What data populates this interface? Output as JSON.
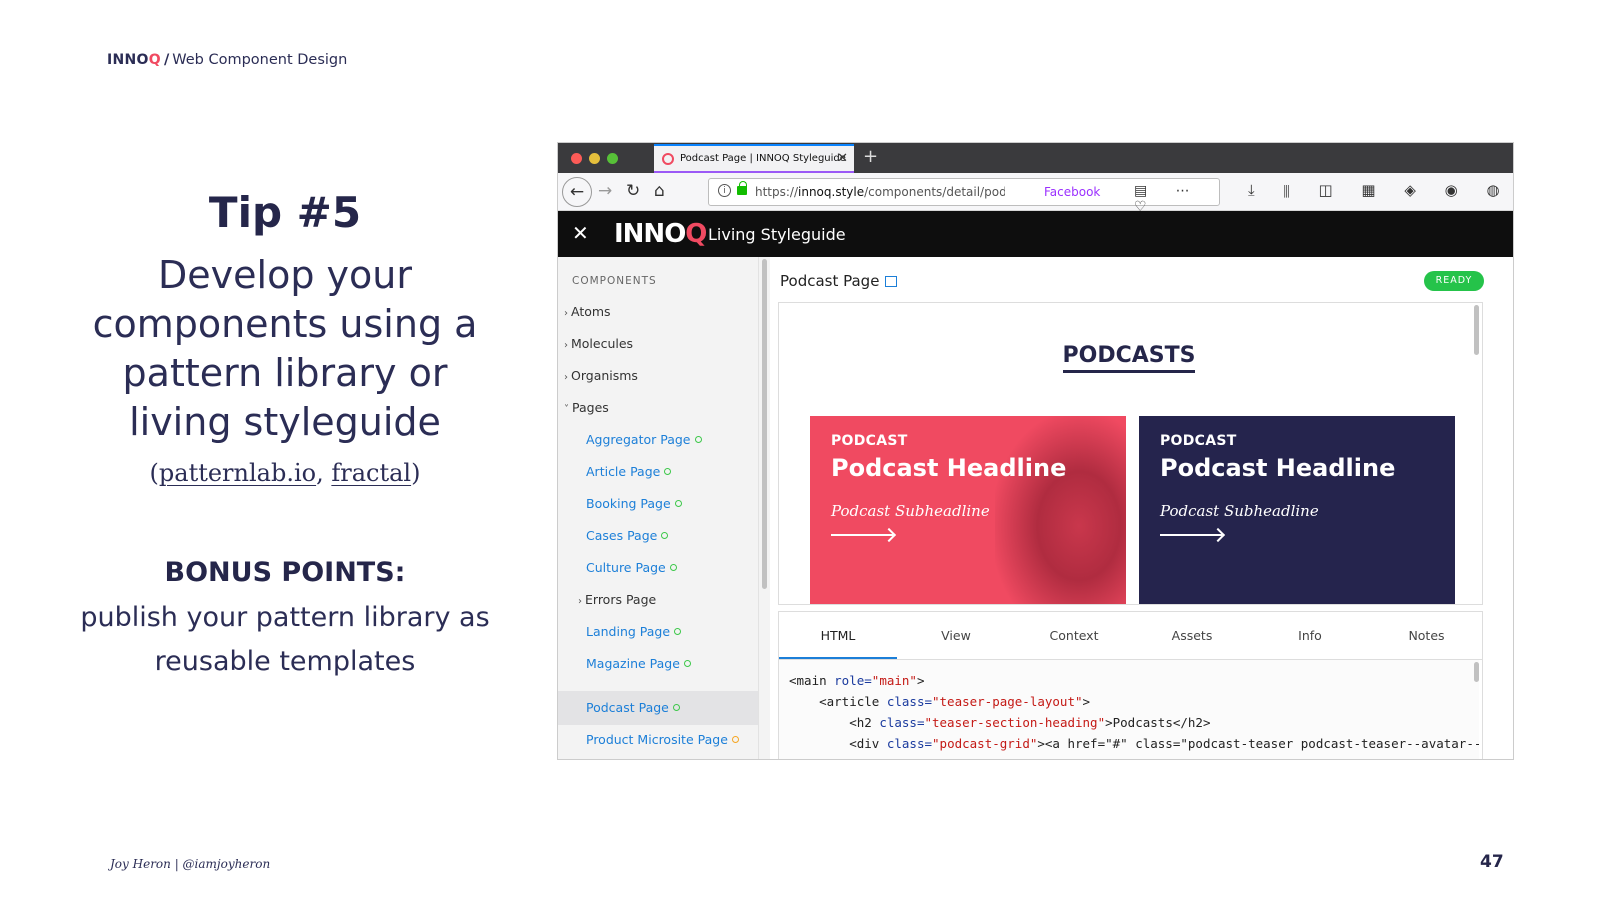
{
  "slide": {
    "brand": "INNO",
    "brand_q": "Q",
    "slash": "/",
    "deck_title": "Web Component Design",
    "tip": "Tip #5",
    "headline_lines": [
      "Develop your",
      "components using a",
      "pattern library or",
      "living styleguide"
    ],
    "tools_open": "(",
    "tool_1": "patternlab.io",
    "tools_sep": ", ",
    "tool_2": "fractal",
    "tools_close": ")",
    "bonus_title": "BONUS POINTS:",
    "bonus_lines": [
      "publish your pattern library as",
      "reusable templates"
    ],
    "footer": "Joy Heron | @iamjoyheron",
    "page_number": "47"
  },
  "browser": {
    "tab_title": "Podcast Page | INNOQ Styleguide",
    "url_prefix": "https://",
    "url_domain": "innoq.style",
    "url_path": "/components/detail/podcast-page",
    "url_extra": "Facebook",
    "styleguide": {
      "logo_main": "INNO",
      "logo_q": "Q",
      "title": "Living Styleguide"
    },
    "sidebar": {
      "heading": "COMPONENTS",
      "groups": [
        "Atoms",
        "Molecules",
        "Organisms",
        "Pages"
      ],
      "pages": [
        "Aggregator Page",
        "Article Page",
        "Booking Page",
        "Cases Page",
        "Culture Page",
        "Errors Page",
        "Landing Page",
        "Magazine Page",
        "Podcast Page",
        "Product Microsite Page"
      ]
    },
    "main": {
      "title": "Podcast Page",
      "status": "READY",
      "preview_heading": "PODCASTS",
      "cards": [
        {
          "label": "PODCAST",
          "headline": "Podcast Headline",
          "sub": "Podcast Subheadline"
        },
        {
          "label": "PODCAST",
          "headline": "Podcast Headline",
          "sub": "Podcast Subheadline"
        }
      ],
      "tabs": [
        "HTML",
        "View",
        "Context",
        "Assets",
        "Info",
        "Notes"
      ],
      "code_lines": [
        {
          "indent": "",
          "t1": "<main ",
          "a1": "role=",
          "v1": "\"main\"",
          "t2": ">"
        },
        {
          "indent": "    ",
          "t1": "<article ",
          "a1": "class=",
          "v1": "\"teaser-page-layout\"",
          "t2": ">"
        },
        {
          "indent": "        ",
          "t1": "<h2 ",
          "a1": "class=",
          "v1": "\"teaser-section-heading\"",
          "t2": ">Podcasts</h2>"
        },
        {
          "indent": "        ",
          "t1": "<div ",
          "a1": "class=",
          "v1": "\"podcast-grid\"",
          "t2": "><a href=\"#\" class=\"podcast-teaser podcast-teaser--avatar--"
        }
      ]
    },
    "colors": {
      "brand_pink": "#f04a61",
      "brand_navy": "#25244d",
      "link_blue": "#1c7fd8",
      "ready_green": "#25c34a"
    }
  }
}
